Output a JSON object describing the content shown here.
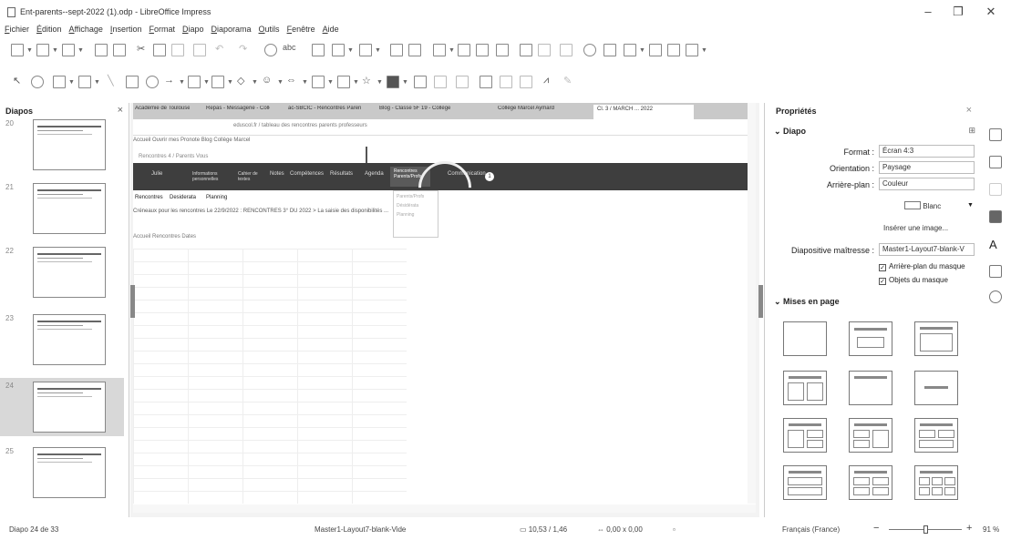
{
  "window": {
    "title": "Ent-parents--sept-2022 (1).odp - LibreOffice Impress",
    "minimize": "–",
    "maximize": "❐",
    "close": "✕"
  },
  "menu": [
    "Fichier",
    "Édition",
    "Affichage",
    "Insertion",
    "Format",
    "Diapo",
    "Diaporama",
    "Outils",
    "Fenêtre",
    "Aide"
  ],
  "toolbar_text": {
    "abc": "abc"
  },
  "slides_pane": {
    "title": "Diapos",
    "items": [
      {
        "num": "20",
        "selected": false
      },
      {
        "num": "21",
        "selected": false
      },
      {
        "num": "22",
        "selected": false
      },
      {
        "num": "23",
        "selected": false
      },
      {
        "num": "24",
        "selected": true
      },
      {
        "num": "25",
        "selected": false
      }
    ]
  },
  "slide_content": {
    "tabs": [
      "Académie de Toulouse",
      "Repas - Messagerie - Collège",
      "ac-SBCIC - Rencontres Parents",
      "Blog - Classe 5F 19 - Collège",
      "Collège Marcel Aymard",
      "Cl. 3 / MARCH ... 2022"
    ],
    "url": "eduscol.fr / tableau des rencontres parents professeurs",
    "bookmarks": "Accueil   Ouvrir mes Pronote   Blog Collège Marcel",
    "crumb": "Rencontres  4 / Parents   Vous",
    "nav": [
      "Julie",
      "Informations personnelles",
      "Cahier de textes",
      "Notes",
      "Compétences",
      "Résultats",
      "Agenda",
      "Rencontres Parents/Profs",
      "Communication"
    ],
    "badge": "1",
    "sub": [
      "Rencontres",
      "Desiderata",
      "Planning"
    ],
    "dropdown": [
      "Parents/Profs",
      "Désidérata",
      "Planning"
    ],
    "info": "Créneaux pour les rencontres   Le 22/9/2022 : RENCONTRES 3° DU 2022 >  La saisie des disponibilités ...",
    "cal": "Accueil      Rencontres      Dates"
  },
  "properties": {
    "title": "Propriétés",
    "section_slide": "Diapo",
    "format_label": "Format :",
    "format_value": "Écran 4:3",
    "orientation_label": "Orientation :",
    "orientation_value": "Paysage",
    "background_label": "Arrière-plan :",
    "background_value": "Couleur",
    "color_value": "Blanc",
    "insert_image": "Insérer une image...",
    "master_label": "Diapositive maîtresse :",
    "master_value": "Master1-Layout7-blank-V",
    "check_master_bg": "Arrière-plan du masque",
    "check_master_objects": "Objets du masque",
    "section_layouts": "Mises en page"
  },
  "status": {
    "slide": "Diapo 24 de 33",
    "master": "Master1-Layout7-blank-Vide",
    "position": "10,53 / 1,46",
    "size": "0,00 x 0,00",
    "language": "Français (France)",
    "zoom": "91 %"
  }
}
